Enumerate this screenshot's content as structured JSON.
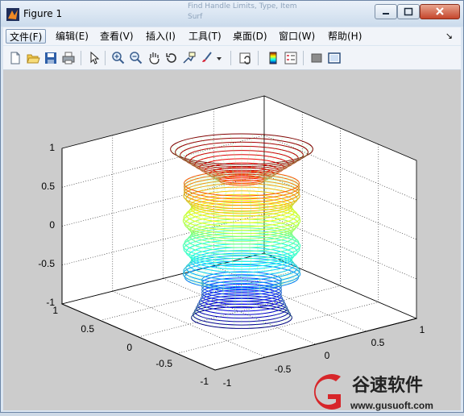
{
  "window": {
    "title": "Figure 1"
  },
  "background_ghost": {
    "line1": "Find Handle Limits, Type, Item",
    "line2": "Surf"
  },
  "menu": {
    "items": [
      {
        "label": "文件(F)",
        "active": true
      },
      {
        "label": "编辑(E)"
      },
      {
        "label": "查看(V)"
      },
      {
        "label": "插入(I)"
      },
      {
        "label": "工具(T)"
      },
      {
        "label": "桌面(D)"
      },
      {
        "label": "窗口(W)"
      },
      {
        "label": "帮助(H)"
      }
    ],
    "overflow_arrow": "↘"
  },
  "toolbar": {
    "icons": [
      "new-figure-icon",
      "open-file-icon",
      "save-icon",
      "print-icon",
      "pointer-icon",
      "zoom-in-icon",
      "zoom-out-icon",
      "pan-hand-icon",
      "rotate-3d-icon",
      "data-cursor-icon",
      "brush-icon",
      "dropdown-arrow-icon",
      "link-plot-icon",
      "colorbar-icon",
      "legend-icon",
      "hide-plot-tools-icon",
      "show-plot-tools-icon"
    ]
  },
  "axes": {
    "z_ticks": [
      "1",
      "0.5",
      "0",
      "-0.5",
      "-1"
    ],
    "y_ticks": [
      "1",
      "0.5",
      "0",
      "-0.5",
      "-1"
    ],
    "x_ticks": [
      "-1",
      "-0.5",
      "0",
      "0.5",
      "1"
    ],
    "grid": "dotted"
  },
  "chart_data": {
    "type": "surface-3d-mesh",
    "z_range": [
      -1,
      1
    ],
    "x_range": [
      -1,
      1
    ],
    "y_range": [
      -1,
      1
    ],
    "colormap": "jet",
    "shape": "surface of revolution: flared cup top, cylindrical middle, narrow waist then flared base"
  },
  "watermark": {
    "brand": "谷速软件",
    "url": "www.gusuoft.com"
  },
  "colors": {
    "title_gradient_top": "#eaf1f9",
    "figure_bg": "#cccccc",
    "close_button": "#c5462c",
    "logo_red": "#d7262a"
  }
}
